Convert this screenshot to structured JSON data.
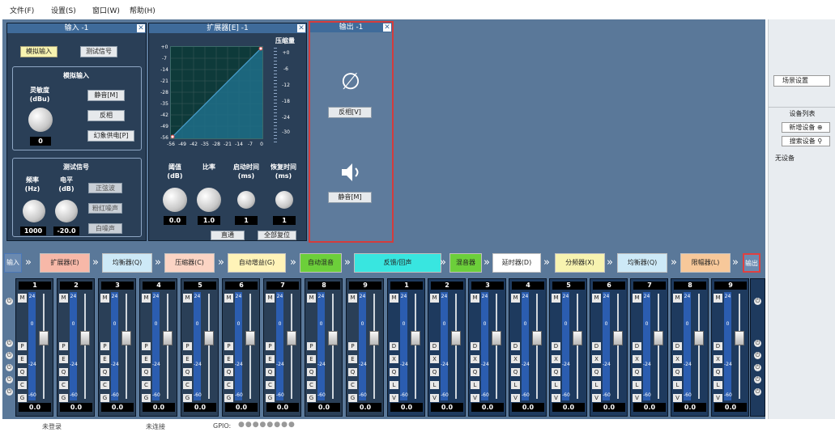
{
  "menu": {
    "file": "文件(F)",
    "settings": "设置(S)",
    "window": "窗口(W)",
    "help": "帮助(H)"
  },
  "input_panel": {
    "title": "输入 -1",
    "analog_btn": "模拟输入",
    "test_btn": "测试信号",
    "analog_section": "模拟输入",
    "sensitivity_label": "灵敏度",
    "sensitivity_unit": "(dBu)",
    "sensitivity_value": "0",
    "mute_btn": "静音[M]",
    "invert_btn": "反相",
    "phantom_btn": "幻象供电[P]",
    "test_section": "测试信号",
    "freq_label": "频率",
    "freq_unit": "(Hz)",
    "level_label": "电平",
    "level_unit": "(dB)",
    "freq_value": "1000",
    "level_value": "-20.0",
    "sine_btn": "正弦波",
    "pink_btn": "粉红噪声",
    "white_btn": "白噪声"
  },
  "expander_panel": {
    "title": "扩展器[E] -1",
    "compression_label": "压缩量",
    "gr_ticks": [
      "+0",
      "-6",
      "-12",
      "-18",
      "-24",
      "-30"
    ],
    "y_ticks": [
      "+0",
      "-7",
      "-14",
      "-21",
      "-28",
      "-35",
      "-42",
      "-49",
      "-56"
    ],
    "x_ticks": [
      "-56",
      "-49",
      "-42",
      "-35",
      "-28",
      "-21",
      "-14",
      "-7",
      "0"
    ],
    "threshold_label": "阈值",
    "threshold_unit": "(dB)",
    "ratio_label": "比率",
    "attack_label": "启动时间",
    "attack_unit": "(ms)",
    "release_label": "恢复时间",
    "release_unit": "(ms)",
    "threshold_value": "0.0",
    "ratio_value": "1.0",
    "attack_value": "1",
    "release_value": "1",
    "bypass_btn": "直通",
    "reset_btn": "全部复位"
  },
  "output_panel": {
    "title": "输出 -1",
    "invert_btn": "反相[V]",
    "mute_btn": "静音[M]"
  },
  "chain": [
    {
      "label": "输入",
      "bg": "#ffffff"
    },
    {
      "label": "扩展器(E)",
      "bg": "#f7b8a8"
    },
    {
      "label": "均衡器(Q)",
      "bg": "#cde9f7"
    },
    {
      "label": "压缩器(C)",
      "bg": "#fbd4c4"
    },
    {
      "label": "自动增益(G)",
      "bg": "#fff3b8"
    },
    {
      "label": "自动混音",
      "bg": "#6ccf3a"
    },
    {
      "label": "反馈/回声",
      "bg": "#38e6e0"
    },
    {
      "label": "混音器",
      "bg": "#6ccf3a"
    },
    {
      "label": "延时器(D)",
      "bg": "#ffffff"
    },
    {
      "label": "分频器(X)",
      "bg": "#f7f3b0"
    },
    {
      "label": "均衡器(Q)",
      "bg": "#cde9f7"
    },
    {
      "label": "限幅器(L)",
      "bg": "#f7c89a"
    },
    {
      "label": "输出",
      "bg": "#f4a8a8"
    }
  ],
  "input_channels": [
    {
      "num": "1",
      "value": "0.0"
    },
    {
      "num": "2",
      "value": "0.0"
    },
    {
      "num": "3",
      "value": "0.0"
    },
    {
      "num": "4",
      "value": "0.0"
    },
    {
      "num": "5",
      "value": "0.0"
    },
    {
      "num": "6",
      "value": "0.0"
    },
    {
      "num": "7",
      "value": "0.0"
    },
    {
      "num": "8",
      "value": "0.0"
    },
    {
      "num": "9",
      "value": "0.0"
    }
  ],
  "output_channels": [
    {
      "num": "1",
      "value": "0.0"
    },
    {
      "num": "2",
      "value": "0.0"
    },
    {
      "num": "3",
      "value": "0.0"
    },
    {
      "num": "4",
      "value": "0.0"
    },
    {
      "num": "5",
      "value": "0.0"
    },
    {
      "num": "6",
      "value": "0.0"
    },
    {
      "num": "7",
      "value": "0.0"
    },
    {
      "num": "8",
      "value": "0.0"
    },
    {
      "num": "9",
      "value": "0.0"
    }
  ],
  "strip_labels": {
    "mute": "M",
    "input_btns": [
      "P",
      "E",
      "Q",
      "C",
      "G"
    ],
    "output_btns": [
      "D",
      "X",
      "Q",
      "L",
      "V"
    ],
    "meter_ticks": [
      "24",
      "0",
      "-24",
      "-60"
    ]
  },
  "right_panel": {
    "scene_btn": "场景设置",
    "devices_title": "设备列表",
    "add_device": "新增设备",
    "search_device": "搜索设备",
    "no_device": "无设备"
  },
  "status": {
    "login": "未登录",
    "connection": "未连接",
    "gpio_label": "GPIO:"
  }
}
